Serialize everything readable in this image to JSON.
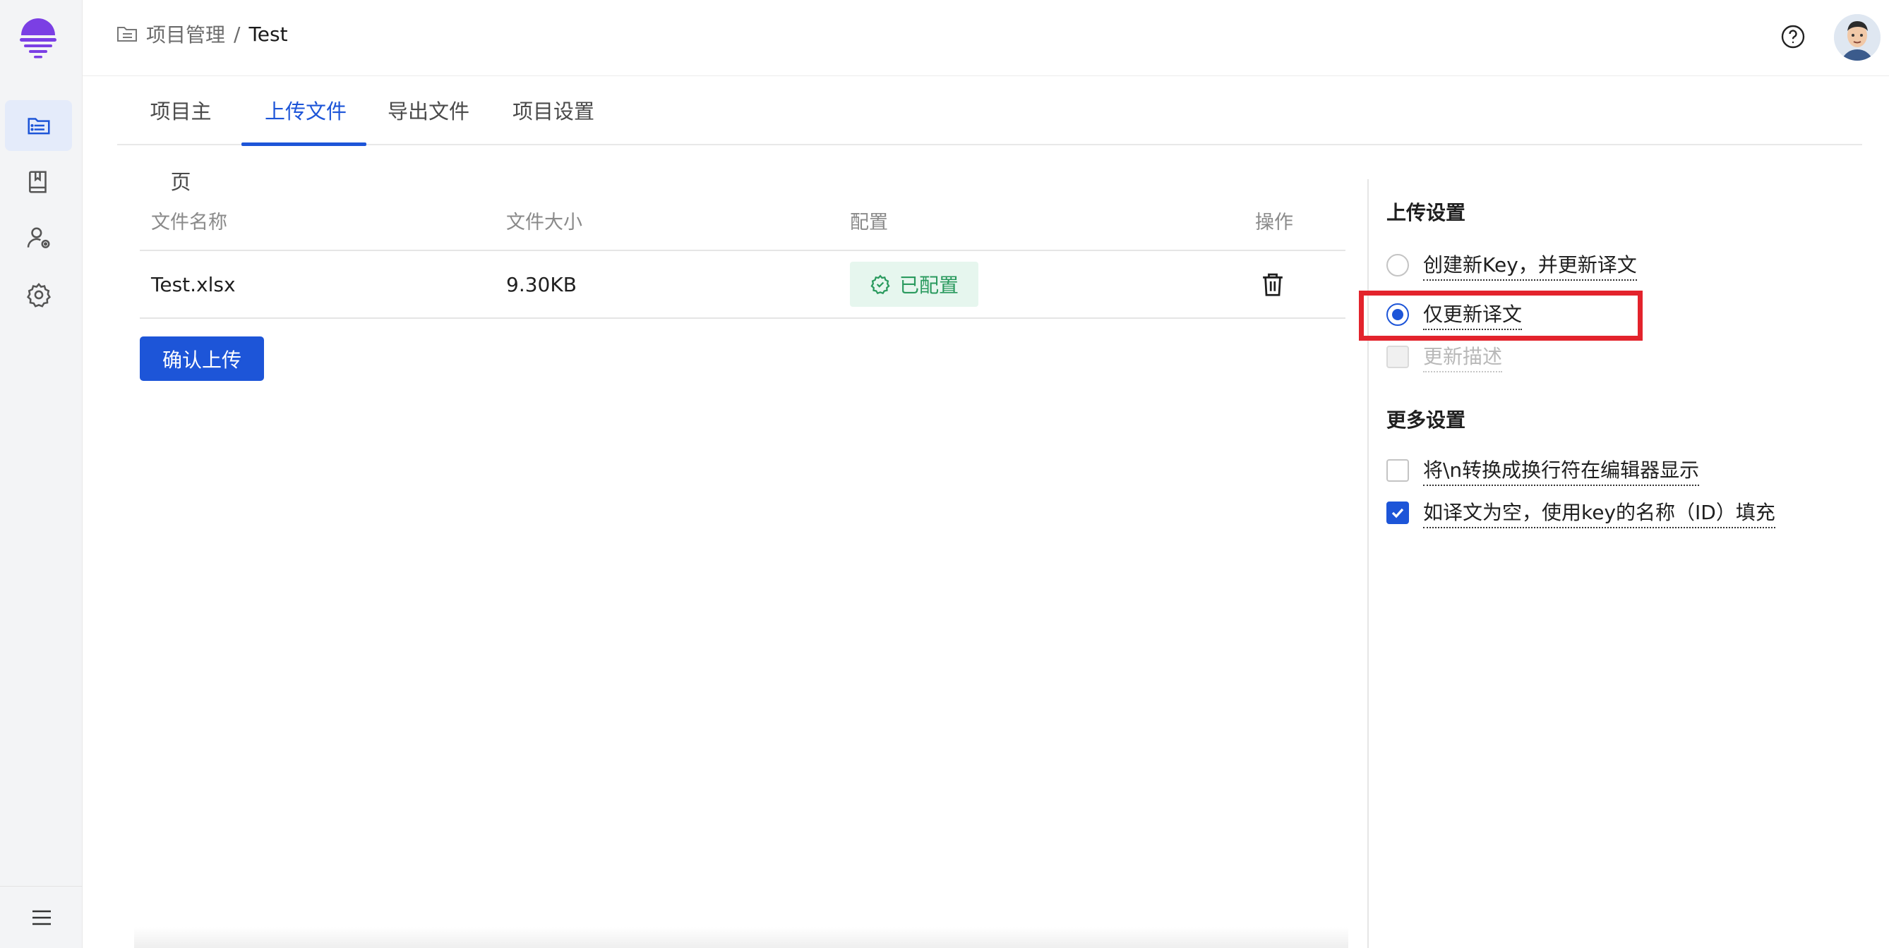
{
  "breadcrumb": {
    "parent": "项目管理",
    "separator": "/",
    "current": "Test"
  },
  "tabs": [
    {
      "label": "项目主页",
      "active": false
    },
    {
      "label": "上传文件",
      "active": true
    },
    {
      "label": "导出文件",
      "active": false
    },
    {
      "label": "项目设置",
      "active": false
    }
  ],
  "table": {
    "headers": [
      "文件名称",
      "文件大小",
      "配置",
      "操作"
    ],
    "rows": [
      {
        "name": "Test.xlsx",
        "size": "9.30KB",
        "config": "已配置"
      }
    ]
  },
  "confirm_button": "确认上传",
  "upload_settings": {
    "title": "上传设置",
    "options": [
      {
        "label": "创建新Key，并更新译文",
        "selected": false
      },
      {
        "label": "仅更新译文",
        "selected": true
      }
    ],
    "update_description": {
      "label": "更新描述",
      "checked": false,
      "disabled": true
    }
  },
  "more_settings": {
    "title": "更多设置",
    "options": [
      {
        "label": "将\\n转换成换行符在编辑器显示",
        "checked": false
      },
      {
        "label": "如译文为空，使用key的名称（ID）填充",
        "checked": true
      }
    ]
  },
  "colors": {
    "accent": "#1d55d8",
    "success": "#2a9a5e",
    "highlight": "#e3232c",
    "logo": "#7b3fe4"
  }
}
